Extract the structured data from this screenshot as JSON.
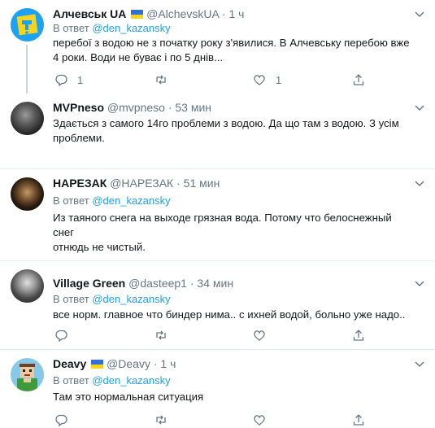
{
  "colors": {
    "accent": "#1da1f2",
    "muted": "#657786",
    "border": "#e6ecf0"
  },
  "tweets": [
    {
      "name": "Алчевськ UA",
      "handle": "@AlchevskUA",
      "sep": "·",
      "time": "1 ч",
      "reply_prefix": "В ответ",
      "reply_to": "@den_kazansky",
      "lines": [
        "перебої з водою не з початку року з'явилися. В Алчевську перебою вже",
        "4 роки. Води не буває і по 5 днів..."
      ],
      "reply_count": "1",
      "like_count": "1",
      "avatar": "yellow-tap-logo"
    },
    {
      "name": "MVPneso",
      "handle": "@mvpneso",
      "sep": "·",
      "time": "53 мин",
      "lines": [
        "Здається з самого 14го проблеми з водою. Да що там з водою. З усім",
        "проблеми."
      ],
      "avatar": "dark-portrait"
    },
    {
      "name": "НАРЕЗАК",
      "handle": "@НАРЕЗАК",
      "sep": "·",
      "time": "51 мин",
      "reply_prefix": "В ответ",
      "reply_to": "@den_kazansky",
      "lines": [
        "Из таяного снега на выходе грязная вода. Потому что белоснежный снег",
        "отнюдь не чистый."
      ],
      "avatar": "dark-portrait"
    },
    {
      "name": "Village Green",
      "handle": "@dasteep1",
      "sep": "·",
      "time": "34 мин",
      "reply_prefix": "В ответ",
      "reply_to": "@den_kazansky",
      "lines": [
        "все норм. главное что биндер нима.. с ихней водой, больно уже надо.."
      ],
      "avatar": "gray-portrait"
    },
    {
      "name": "Deavy",
      "handle": "@Deavy",
      "sep": "·",
      "time": "1 ч",
      "reply_prefix": "В ответ",
      "reply_to": "@den_kazansky",
      "lines": [
        "Там это нормальная ситуация"
      ],
      "avatar": "pixel-art"
    }
  ]
}
